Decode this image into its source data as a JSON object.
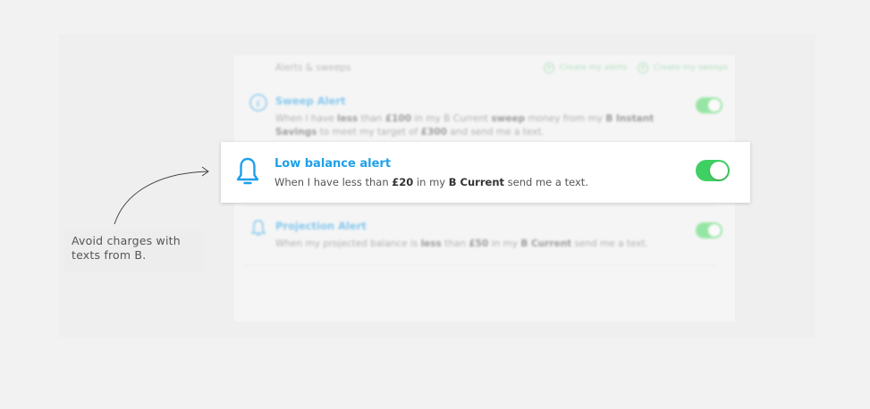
{
  "callout": {
    "text_line1": "Avoid charges with",
    "text_line2": "texts from B."
  },
  "panel": {
    "title": "Alerts & sweeps",
    "create_alert_label": "Create my alerts",
    "create_sweep_label": "Create my sweeps",
    "sweep_alert": {
      "title": "Sweep Alert",
      "desc": {
        "p1": "When I have ",
        "b1": "less",
        "p2": " than ",
        "b2": "£100",
        "p3": " in my B Current ",
        "b3": "sweep",
        "p4": " money from my ",
        "b4": "B Instant Savings",
        "p5": " to meet my target of ",
        "b5": "£300",
        "p6": " and send me a text."
      },
      "enabled": true,
      "icon": "pound-circle-icon"
    },
    "projection_alert": {
      "title": "Projection Alert",
      "desc": {
        "p1": "When my projected balance is ",
        "b1": "less",
        "p2": " than ",
        "b2": "£50",
        "p3": " in my ",
        "b3": "B Current",
        "p4": " send me a text."
      },
      "enabled": true,
      "icon": "bell-icon"
    }
  },
  "highlight": {
    "title": "Low balance alert",
    "desc": {
      "p1": "When I have less than ",
      "b1": "£20",
      "p2": " in my ",
      "b2": "B Current",
      "p3": " send me a text."
    },
    "enabled": true,
    "icon": "bell-icon"
  },
  "colors": {
    "accent_blue": "#1ea0ea",
    "toggle_green": "#3fd063",
    "background": "#f2f2f2"
  }
}
